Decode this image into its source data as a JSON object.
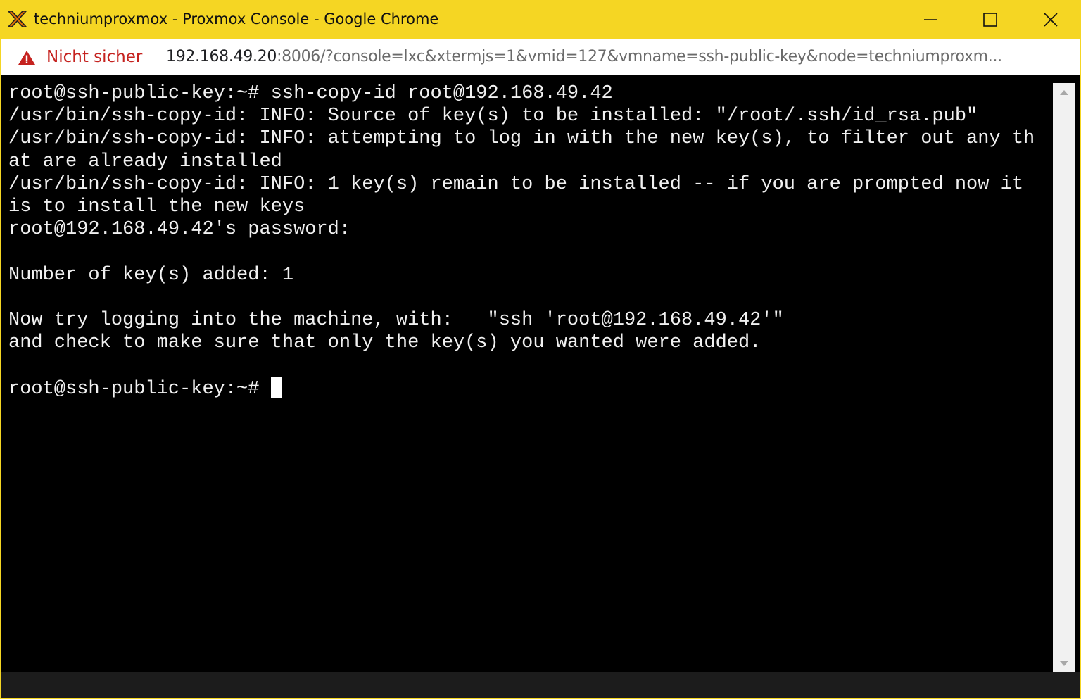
{
  "window": {
    "title": "techniumproxmox - Proxmox Console - Google Chrome",
    "accent_color": "#f5d623",
    "controls": {
      "minimize_icon": "minimize-icon",
      "maximize_icon": "maximize-icon",
      "close_icon": "close-icon"
    }
  },
  "app_icon": "proxmox-x-logo",
  "addressbar": {
    "security_icon": "warning-triangle-icon",
    "security_label": "Nicht sicher",
    "security_color": "#c5221f",
    "url_host": "192.168.49.20",
    "url_rest": ":8006/?console=lxc&xtermjs=1&vmid=127&vmname=ssh-public-key&node=techniumproxm..."
  },
  "terminal": {
    "lines": [
      "root@ssh-public-key:~# ssh-copy-id root@192.168.49.42",
      "/usr/bin/ssh-copy-id: INFO: Source of key(s) to be installed: \"/root/.ssh/id_rsa.pub\"",
      "/usr/bin/ssh-copy-id: INFO: attempting to log in with the new key(s), to filter out any th",
      "at are already installed",
      "/usr/bin/ssh-copy-id: INFO: 1 key(s) remain to be installed -- if you are prompted now it",
      "is to install the new keys",
      "root@192.168.49.42's password:",
      "",
      "Number of key(s) added: 1",
      "",
      "Now try logging into the machine, with:   \"ssh 'root@192.168.49.42'\"",
      "and check to make sure that only the key(s) you wanted were added.",
      ""
    ],
    "prompt": "root@ssh-public-key:~# ",
    "background": "#000000",
    "foreground": "#f0f0f0"
  },
  "scrollbar": {
    "up_icon": "scroll-up-arrow-icon",
    "down_icon": "scroll-down-arrow-icon"
  }
}
